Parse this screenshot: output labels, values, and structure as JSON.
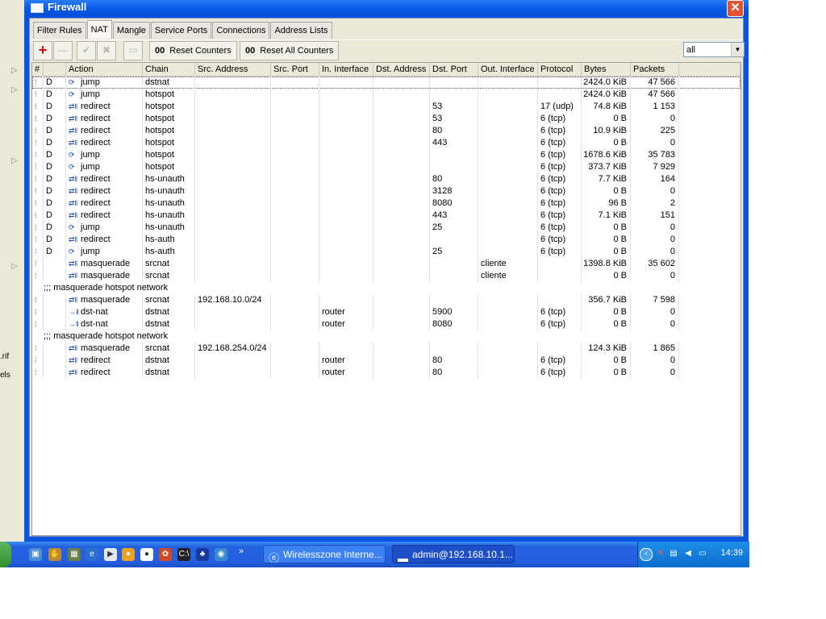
{
  "window": {
    "title": "Firewall",
    "close_label": "✕"
  },
  "tabs": [
    "Filter Rules",
    "NAT",
    "Mangle",
    "Service Ports",
    "Connections",
    "Address Lists"
  ],
  "active_tab": "NAT",
  "toolbar": {
    "reset_counters": "Reset Counters",
    "reset_all_counters": "Reset All Counters",
    "counter_prefix": "00",
    "filter_value": "all"
  },
  "columns": [
    "#",
    "",
    "Action",
    "Chain",
    "Src. Address",
    "Src. Port",
    "In. Interface",
    "Dst. Address",
    "Dst. Port",
    "Out. Interface",
    "Protocol",
    "Bytes",
    "Packets"
  ],
  "rows": [
    {
      "flag": "D",
      "action": "jump",
      "icon": "jump-icon",
      "chain": "dstnat",
      "src": "",
      "sport": "",
      "in": "",
      "dst": "",
      "dport": "",
      "out": "",
      "proto": "",
      "bytes": "2424.0 KiB",
      "packets": "47 566"
    },
    {
      "flag": "D",
      "action": "jump",
      "icon": "jump-icon",
      "chain": "hotspot",
      "src": "",
      "sport": "",
      "in": "",
      "dst": "",
      "dport": "",
      "out": "",
      "proto": "",
      "bytes": "2424.0 KiB",
      "packets": "47 566"
    },
    {
      "flag": "D",
      "action": "redirect",
      "icon": "redirect-icon",
      "chain": "hotspot",
      "src": "",
      "sport": "",
      "in": "",
      "dst": "",
      "dport": "53",
      "out": "",
      "proto": "17 (udp)",
      "bytes": "74.8 KiB",
      "packets": "1 153"
    },
    {
      "flag": "D",
      "action": "redirect",
      "icon": "redirect-icon",
      "chain": "hotspot",
      "src": "",
      "sport": "",
      "in": "",
      "dst": "",
      "dport": "53",
      "out": "",
      "proto": "6 (tcp)",
      "bytes": "0 B",
      "packets": "0"
    },
    {
      "flag": "D",
      "action": "redirect",
      "icon": "redirect-icon",
      "chain": "hotspot",
      "src": "",
      "sport": "",
      "in": "",
      "dst": "",
      "dport": "80",
      "out": "",
      "proto": "6 (tcp)",
      "bytes": "10.9 KiB",
      "packets": "225"
    },
    {
      "flag": "D",
      "action": "redirect",
      "icon": "redirect-icon",
      "chain": "hotspot",
      "src": "",
      "sport": "",
      "in": "",
      "dst": "",
      "dport": "443",
      "out": "",
      "proto": "6 (tcp)",
      "bytes": "0 B",
      "packets": "0"
    },
    {
      "flag": "D",
      "action": "jump",
      "icon": "jump-icon",
      "chain": "hotspot",
      "src": "",
      "sport": "",
      "in": "",
      "dst": "",
      "dport": "",
      "out": "",
      "proto": "6 (tcp)",
      "bytes": "1678.6 KiB",
      "packets": "35 783"
    },
    {
      "flag": "D",
      "action": "jump",
      "icon": "jump-icon",
      "chain": "hotspot",
      "src": "",
      "sport": "",
      "in": "",
      "dst": "",
      "dport": "",
      "out": "",
      "proto": "6 (tcp)",
      "bytes": "373.7 KiB",
      "packets": "7 929"
    },
    {
      "flag": "D",
      "action": "redirect",
      "icon": "redirect-icon",
      "chain": "hs-unauth",
      "src": "",
      "sport": "",
      "in": "",
      "dst": "",
      "dport": "80",
      "out": "",
      "proto": "6 (tcp)",
      "bytes": "7.7 KiB",
      "packets": "164"
    },
    {
      "flag": "D",
      "action": "redirect",
      "icon": "redirect-icon",
      "chain": "hs-unauth",
      "src": "",
      "sport": "",
      "in": "",
      "dst": "",
      "dport": "3128",
      "out": "",
      "proto": "6 (tcp)",
      "bytes": "0 B",
      "packets": "0"
    },
    {
      "flag": "D",
      "action": "redirect",
      "icon": "redirect-icon",
      "chain": "hs-unauth",
      "src": "",
      "sport": "",
      "in": "",
      "dst": "",
      "dport": "8080",
      "out": "",
      "proto": "6 (tcp)",
      "bytes": "96 B",
      "packets": "2"
    },
    {
      "flag": "D",
      "action": "redirect",
      "icon": "redirect-icon",
      "chain": "hs-unauth",
      "src": "",
      "sport": "",
      "in": "",
      "dst": "",
      "dport": "443",
      "out": "",
      "proto": "6 (tcp)",
      "bytes": "7.1 KiB",
      "packets": "151"
    },
    {
      "flag": "D",
      "action": "jump",
      "icon": "jump-icon",
      "chain": "hs-unauth",
      "src": "",
      "sport": "",
      "in": "",
      "dst": "",
      "dport": "25",
      "out": "",
      "proto": "6 (tcp)",
      "bytes": "0 B",
      "packets": "0"
    },
    {
      "flag": "D",
      "action": "redirect",
      "icon": "redirect-icon",
      "chain": "hs-auth",
      "src": "",
      "sport": "",
      "in": "",
      "dst": "",
      "dport": "",
      "out": "",
      "proto": "6 (tcp)",
      "bytes": "0 B",
      "packets": "0"
    },
    {
      "flag": "D",
      "action": "jump",
      "icon": "jump-icon",
      "chain": "hs-auth",
      "src": "",
      "sport": "",
      "in": "",
      "dst": "",
      "dport": "25",
      "out": "",
      "proto": "6 (tcp)",
      "bytes": "0 B",
      "packets": "0"
    },
    {
      "flag": "",
      "action": "masquerade",
      "icon": "masquerade-icon",
      "chain": "srcnat",
      "src": "",
      "sport": "",
      "in": "",
      "dst": "",
      "dport": "",
      "out": "cliente",
      "proto": "",
      "bytes": "1398.8 KiB",
      "packets": "35 602"
    },
    {
      "flag": "",
      "action": "masquerade",
      "icon": "masquerade-icon",
      "chain": "srcnat",
      "src": "",
      "sport": "",
      "in": "",
      "dst": "",
      "dport": "",
      "out": "cliente",
      "proto": "",
      "bytes": "0 B",
      "packets": "0"
    },
    {
      "comment": ";;; masquerade hotspot network"
    },
    {
      "flag": "",
      "action": "masquerade",
      "icon": "masquerade-icon",
      "chain": "srcnat",
      "src": "192.168.10.0/24",
      "sport": "",
      "in": "",
      "dst": "",
      "dport": "",
      "out": "",
      "proto": "",
      "bytes": "356.7 KiB",
      "packets": "7 598"
    },
    {
      "flag": "",
      "action": "dst-nat",
      "icon": "dst-nat-icon",
      "chain": "dstnat",
      "src": "",
      "sport": "",
      "in": "router",
      "dst": "",
      "dport": "5900",
      "out": "",
      "proto": "6 (tcp)",
      "bytes": "0 B",
      "packets": "0"
    },
    {
      "flag": "",
      "action": "dst-nat",
      "icon": "dst-nat-icon",
      "chain": "dstnat",
      "src": "",
      "sport": "",
      "in": "router",
      "dst": "",
      "dport": "8080",
      "out": "",
      "proto": "6 (tcp)",
      "bytes": "0 B",
      "packets": "0"
    },
    {
      "comment": ";;; masquerade hotspot network"
    },
    {
      "flag": "",
      "action": "masquerade",
      "icon": "masquerade-icon",
      "chain": "srcnat",
      "src": "192.168.254.0/24",
      "sport": "",
      "in": "",
      "dst": "",
      "dport": "",
      "out": "",
      "proto": "",
      "bytes": "124.3 KiB",
      "packets": "1 865"
    },
    {
      "flag": "",
      "action": "redirect",
      "icon": "redirect-icon",
      "chain": "dstnat",
      "src": "",
      "sport": "",
      "in": "router",
      "dst": "",
      "dport": "80",
      "out": "",
      "proto": "6 (tcp)",
      "bytes": "0 B",
      "packets": "0"
    },
    {
      "flag": "",
      "action": "redirect",
      "icon": "redirect-icon",
      "chain": "dstnat",
      "src": "",
      "sport": "",
      "in": "router",
      "dst": "",
      "dport": "80",
      "out": "",
      "proto": "6 (tcp)",
      "bytes": "0 B",
      "packets": "0"
    }
  ],
  "left_strip": {
    "labels": [
      ".rif",
      "els"
    ]
  },
  "taskbar": {
    "tasks": [
      "Wirelesszone Interne...",
      "admin@192.168.10.1..."
    ],
    "clock": "14:39"
  }
}
